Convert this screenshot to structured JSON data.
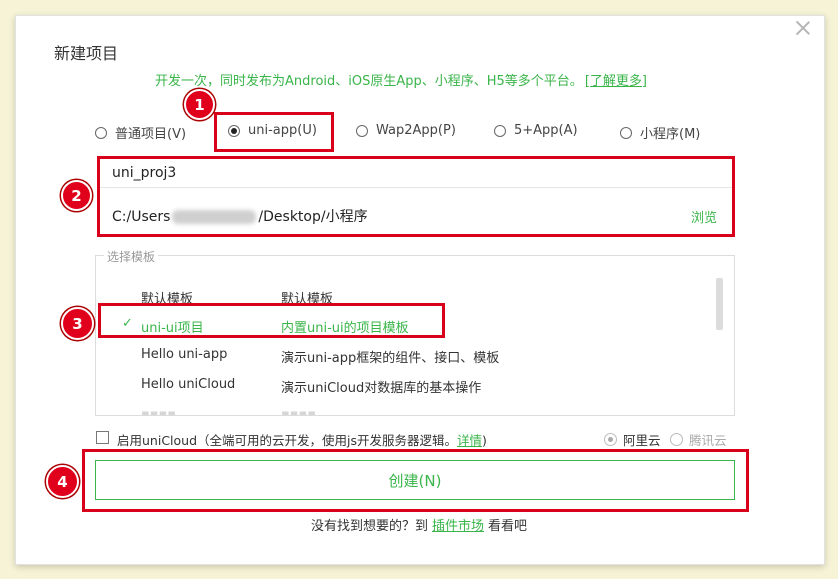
{
  "dialog": {
    "title": "新建项目",
    "subtitle": "开发一次，同时发布为Android、iOS原生App、小程序、H5等多个平台。",
    "learn_more": "[了解更多]"
  },
  "project_types": [
    {
      "label": "普通项目(V)",
      "selected": false
    },
    {
      "label": "uni-app(U)",
      "selected": true
    },
    {
      "label": "Wap2App(P)",
      "selected": false
    },
    {
      "label": "5+App(A)",
      "selected": false
    },
    {
      "label": "小程序(M)",
      "selected": false
    }
  ],
  "form": {
    "project_name": "uni_proj3",
    "path_prefix": "C:/Users",
    "path_suffix": "/Desktop/小程序",
    "browse_label": "浏览"
  },
  "templates": {
    "legend": "选择模板",
    "rows": [
      {
        "name": "默认模板",
        "desc": "默认模板"
      },
      {
        "name": "uni-ui项目",
        "desc": "内置uni-ui的项目模板",
        "active": true
      },
      {
        "name": "Hello uni-app",
        "desc": "演示uni-app框架的组件、接口、模板"
      },
      {
        "name": "Hello uniCloud",
        "desc": "演示uniCloud对数据库的基本操作"
      }
    ],
    "check_glyph": "✓"
  },
  "unicloud": {
    "label": "启用uniCloud（全端可用的云开发，使用js开发服务器逻辑。",
    "details_link": "详情",
    "close_paren": ")",
    "aliyun_label": "阿里云",
    "tencent_label": "腾讯云"
  },
  "create_button": "创建(N)",
  "footer": {
    "prefix": "没有找到想要的？到",
    "link": "插件市场",
    "suffix": "看看吧"
  },
  "annotations": {
    "badge_1": "1",
    "badge_2": "2",
    "badge_3": "3",
    "badge_4": "4",
    "color": "#d9001b"
  }
}
